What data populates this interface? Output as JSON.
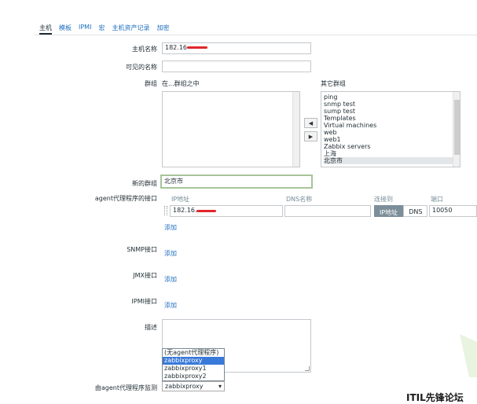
{
  "tabs": [
    "主机",
    "模板",
    "IPMI",
    "宏",
    "主机资产记录",
    "加密"
  ],
  "form": {
    "host_name_label": "主机名称",
    "host_name_value": "182.16",
    "visible_name_label": "可见的名称",
    "visible_name_value": "",
    "groups_label": "群组",
    "in_groups_label": "在...群组之中",
    "other_groups_label": "其它群组",
    "other_groups": [
      "ping",
      "snmp test",
      "sump test",
      "Templates",
      "Virtual machines",
      "web",
      "web1",
      "Zabbix servers",
      "上海",
      "北京市"
    ],
    "other_groups_selected": "北京市",
    "move_left": "◀",
    "move_right": "▶",
    "new_group_label": "新的群组",
    "new_group_value": "北京市",
    "agent_interface_label": "agent代理程序的接口",
    "col_ip": "IP地址",
    "col_dns": "DNS名称",
    "col_connect": "连接到",
    "col_port": "端口",
    "agent_ip_value": "182.16.",
    "agent_dns_value": "",
    "connect_ip": "IP地址",
    "connect_dns": "DNS",
    "agent_port_value": "10050",
    "add_label": "添加",
    "snmp_label": "SNMP接口",
    "jmx_label": "JMX接口",
    "ipmi_label": "IPMI接口",
    "description_label": "描述",
    "proxy_label": "由agent代理程序监测",
    "proxy_selected": "zabbixproxy",
    "proxy_options": [
      "(无agent代理程序)",
      "zabbixproxy",
      "zabbixproxy1",
      "zabbixproxy2"
    ],
    "proxy_highlighted": "zabbixproxy"
  },
  "watermark": "ITIL先锋论坛",
  "colors": {
    "link": "#1f6fbf",
    "highlight": "#3879d9",
    "redaction": "#e0262b"
  }
}
